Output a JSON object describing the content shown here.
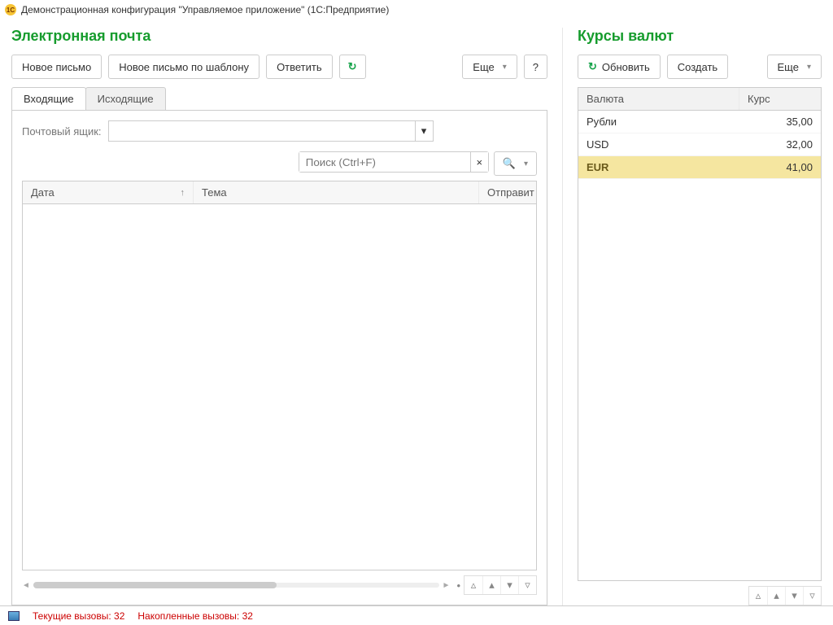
{
  "titlebar": {
    "icon_text": "1C",
    "text": "Демонстрационная конфигурация \"Управляемое приложение\"  (1С:Предприятие)"
  },
  "email": {
    "title": "Электронная почта",
    "toolbar": {
      "new": "Новое письмо",
      "new_template": "Новое письмо по шаблону",
      "reply": "Ответить",
      "more": "Еще",
      "help": "?"
    },
    "tabs": {
      "inbox": "Входящие",
      "outbox": "Исходящие"
    },
    "mailbox_label": "Почтовый ящик:",
    "search_placeholder": "Поиск (Ctrl+F)",
    "clear": "×",
    "columns": {
      "date": "Дата",
      "subject": "Тема",
      "sender": "Отправит"
    }
  },
  "rates": {
    "title": "Курсы валют",
    "toolbar": {
      "refresh": "Обновить",
      "create": "Создать",
      "more": "Еще"
    },
    "columns": {
      "name": "Валюта",
      "rate": "Курс"
    },
    "rows": [
      {
        "name": "Рубли",
        "rate": "35,00"
      },
      {
        "name": "USD",
        "rate": "32,00"
      },
      {
        "name": "EUR",
        "rate": "41,00"
      }
    ],
    "selected_index": 2
  },
  "status": {
    "current_label": "Текущие вызовы:",
    "current_value": "32",
    "acc_label": "Накопленные вызовы:",
    "acc_value": "32"
  }
}
